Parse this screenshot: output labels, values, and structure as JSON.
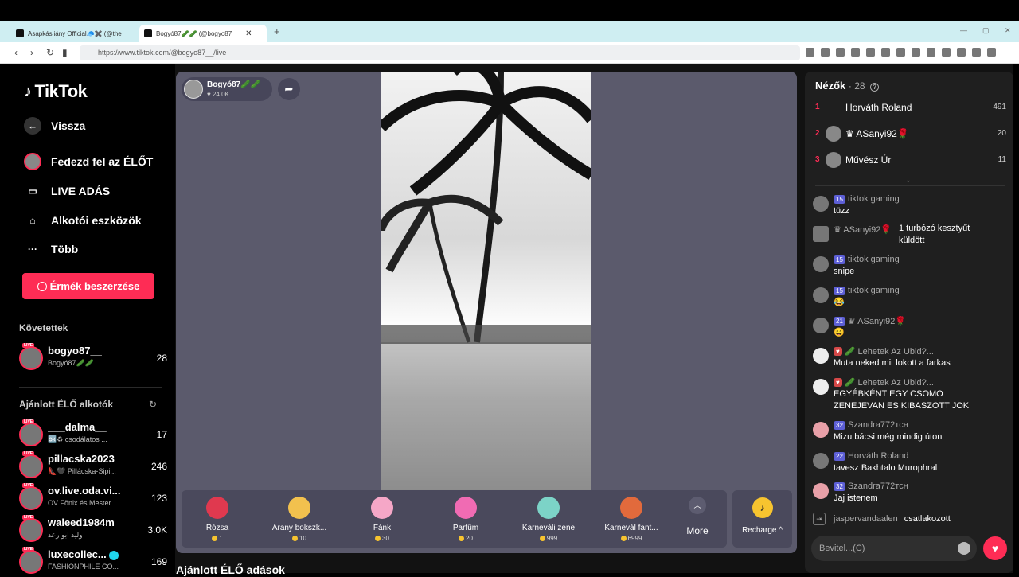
{
  "browser": {
    "tabs": [
      {
        "title": "Asapkásliány Official🧢✖️ (@the"
      },
      {
        "title": "Bogyó87🥒🥒 (@bogyo87__"
      }
    ],
    "url": "https://www.tiktok.com/@bogyo87__/live"
  },
  "sidebar": {
    "logo": "TikTok",
    "back": "Vissza",
    "nav": [
      "Fedezd fel az ÉLŐT",
      "LIVE ADÁS",
      "Alkotói eszközök",
      "Több"
    ],
    "coins_button": "Érmék beszerzése",
    "followed_title": "Követettek",
    "followed": [
      {
        "name": "bogyo87__",
        "sub": "Bogyó87🥒🥒",
        "count": "28"
      }
    ],
    "recommended_title": "Ajánlott ÉLŐ alkotók",
    "recommended": [
      {
        "name": "___dalma__",
        "sub": "🆗♻ csodálatos ...",
        "count": "17"
      },
      {
        "name": "pillacska2023",
        "sub": "👠🖤 Pillácska-Sipi...",
        "count": "246"
      },
      {
        "name": "ov.live.oda.vi...",
        "sub": "OV Fõnix és Mester...",
        "count": "123"
      },
      {
        "name": "waleed1984m",
        "sub": "وليد ابو رعد",
        "count": "3.0K"
      },
      {
        "name": "luxecollec...",
        "sub": "FASHIONPHILE CO...",
        "count": "169"
      }
    ],
    "live_label": "LIVE"
  },
  "player": {
    "host_name": "Bogyó87🥒🥒",
    "host_likes": "♥ 24.0K",
    "gifts": [
      {
        "name": "Rózsa",
        "price": "1",
        "color": "#e0394f"
      },
      {
        "name": "Arany bokszk...",
        "price": "10",
        "color": "#f2c14e"
      },
      {
        "name": "Fánk",
        "price": "30",
        "color": "#f5a7c7"
      },
      {
        "name": "Parfüm",
        "price": "20",
        "color": "#f06bb3"
      },
      {
        "name": "Karneváli zene",
        "price": "999",
        "color": "#7cd3c7"
      },
      {
        "name": "Karnevál fant...",
        "price": "6999",
        "color": "#e26a3c"
      }
    ],
    "more": "More",
    "recharge": "Recharge ^"
  },
  "recommended_lives_title": "Ajánlott ÉLŐ adások",
  "chat": {
    "viewers_label": "Nézők",
    "viewers_count": "· 28",
    "ranking": [
      {
        "rank": "1",
        "name": "Horváth Roland",
        "score": "491"
      },
      {
        "rank": "2",
        "name": "♛ ASanyi92🌹",
        "score": "20"
      },
      {
        "rank": "3",
        "name": "Művész Úr",
        "score": "11"
      }
    ],
    "messages": [
      {
        "user": "tiktok gaming",
        "text": "tüzz",
        "badge": "15"
      },
      {
        "user": "♛ ASanyi92🌹",
        "text": "1 turbózó kesztyűt küldött",
        "badge": ""
      },
      {
        "user": "tiktok gaming",
        "text": "snipe",
        "badge": "15"
      },
      {
        "user": "tiktok gaming",
        "text": "😂",
        "badge": "15"
      },
      {
        "user": "♛ ASanyi92🌹",
        "text": "😄",
        "badge": "21"
      },
      {
        "user": "🥒 Lehetek Az Ubid?...",
        "text": "Muta neked mit lokott a farkas",
        "badge": ""
      },
      {
        "user": "🥒 Lehetek Az Ubid?...",
        "text": "EGYÉBKÉNT EGY CSOMO ZENEJEVAN ES KIBASZOTT JOK",
        "badge": ""
      },
      {
        "user": "Szandra772ᴛᴄʜ",
        "text": "Mizu bácsi még mindig úton",
        "badge": "32"
      },
      {
        "user": "Horváth Roland",
        "text": "tavesz Bakhtalo Murophral",
        "badge": "22"
      },
      {
        "user": "Szandra772ᴛᴄʜ",
        "text": "Jaj istenem",
        "badge": "32"
      }
    ],
    "joined_user": "jaspervandaalen",
    "joined_text": "csatlakozott",
    "input_placeholder": "Bevitel...(C)"
  }
}
